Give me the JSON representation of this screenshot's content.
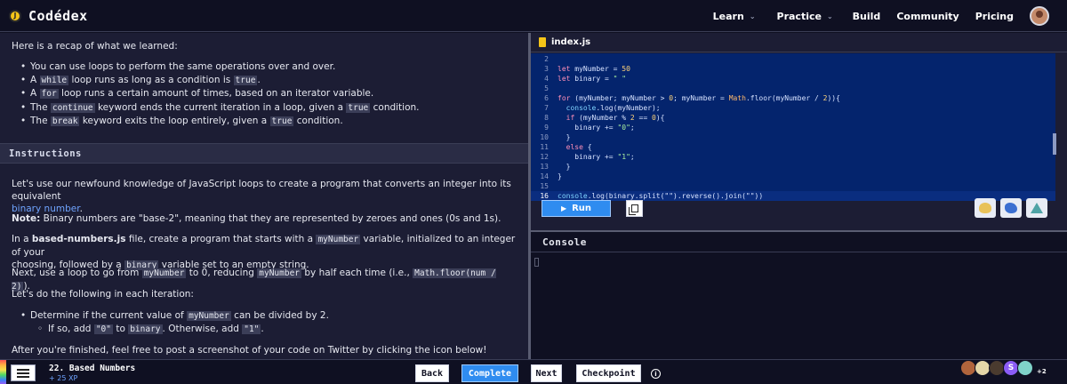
{
  "brand": {
    "name": "Codédex",
    "logo_glyph": "J"
  },
  "nav": {
    "items": [
      {
        "label": "Learn",
        "has_dropdown": true
      },
      {
        "label": "Practice",
        "has_dropdown": true
      },
      {
        "label": "Build",
        "has_dropdown": false
      },
      {
        "label": "Community",
        "has_dropdown": false
      },
      {
        "label": "Pricing",
        "has_dropdown": false
      }
    ],
    "chevron": "⌄"
  },
  "lesson": {
    "recap_intro": "Here is a recap of what we learned:",
    "recap": [
      {
        "pre": "You can use loops to perform the same operations over and over.",
        "code": "",
        "post": ""
      },
      {
        "pre": "A ",
        "code": "while",
        "post": " loop runs as long as a condition is ",
        "code2": "true",
        "post2": "."
      },
      {
        "pre": "A ",
        "code": "for",
        "post": " loop runs a certain amount of times, based on an iterator variable.",
        "code2": "",
        "post2": ""
      },
      {
        "pre": "The ",
        "code": "continue",
        "post": " keyword ends the current iteration in a loop, given a ",
        "code2": "true",
        "post2": " condition."
      },
      {
        "pre": "The ",
        "code": "break",
        "post": " keyword exits the loop entirely, given a ",
        "code2": "true",
        "post2": " condition."
      }
    ],
    "instructions_title": "Instructions",
    "p1_pre": "Let's use our newfound knowledge of JavaScript loops to create a program that converts an integer into its equivalent",
    "p1_link": "binary number",
    "p1_post": ".",
    "p2_bold": "Note:",
    "p2_rest": " Binary numbers are \"base-2\", meaning that they are represented by zeroes and ones (0s and 1s).",
    "p3_a": "In a ",
    "p3_bold": "based-numbers.js",
    "p3_b": " file, create a program that starts with a ",
    "p3_code1": "myNumber",
    "p3_c": " variable, initialized to an integer of your",
    "p3_d": "choosing, followed by a ",
    "p3_code2": "binary",
    "p3_e": " variable set to an empty string.",
    "p4_a": "Next, use a loop to go from ",
    "p4_code1": "myNumber",
    "p4_b": " to 0, reducing ",
    "p4_code2": "myNumber",
    "p4_c": " by half each time (i.e., ",
    "p4_code3": "Math.floor(num / 2)",
    "p4_d": ").",
    "p5": "Let's do the following in each iteration:",
    "step1_a": "Determine if the current value of ",
    "step1_code": "myNumber",
    "step1_b": " can be divided by 2.",
    "step2_a": "If so, add ",
    "step2_code1": "\"0\"",
    "step2_b": " to ",
    "step2_code2": "binary",
    "step2_c": ". Otherwise, add ",
    "step2_code3": "\"1\"",
    "step2_d": ".",
    "p6": "After you're finished, feel free to post a screenshot of your code on Twitter by clicking the icon below!"
  },
  "editor": {
    "file_name": "index.js",
    "line_numbers": [
      "2",
      "3",
      "4",
      "5",
      "6",
      "7",
      "8",
      "9",
      "10",
      "11",
      "12",
      "13",
      "14",
      "15",
      "16"
    ],
    "lines": {
      "l3_kw": "let",
      "l3_rest": " myNumber = ",
      "l3_num": "50",
      "l4_kw": "let",
      "l4_rest": " binary = ",
      "l4_str": "\" \"",
      "l6_kw": "for",
      "l6_a": " (myNumber; myNumber > ",
      "l6_num": "0",
      "l6_b": "; myNumber = ",
      "l6_obj": "Math",
      "l6_c": ".floor(myNumber / ",
      "l6_num2": "2",
      "l6_d": ")){",
      "l7_fn": "console",
      "l7_rest": ".log(myNumber);",
      "l8_kw": "if",
      "l8_a": " (myNumber % ",
      "l8_num": "2",
      "l8_b": " == ",
      "l8_num2": "0",
      "l8_c": "){",
      "l9_a": "binary += ",
      "l9_str": "\"0\"",
      "l9_b": ";",
      "l10": "}",
      "l11_kw": "else",
      "l11_rest": " {",
      "l12_a": "binary += ",
      "l12_str": "\"1\"",
      "l12_b": ";",
      "l13": "}",
      "l14": "}",
      "l16_fn": "console",
      "l16_rest": ".log(binary.split(\"\").reverse().join(\"\"))"
    },
    "run_label": "Run",
    "run_glyph": "▶"
  },
  "console": {
    "title": "Console"
  },
  "footer": {
    "lesson_title": "22. Based Numbers",
    "xp": "+ 25 XP",
    "back_label": "Back",
    "complete_label": "Complete",
    "next_label": "Next",
    "checkpoint_label": "Checkpoint",
    "info_glyph": "i",
    "collaborator_initial": "S",
    "more_count": "+2"
  },
  "colors": {
    "background": "#0f1022",
    "panel": "#1c1d34",
    "editor_bg": "#04246d",
    "accent_blue": "#2f8cf0",
    "link": "#6fa4ff",
    "brand_coin": "#f5c518"
  }
}
